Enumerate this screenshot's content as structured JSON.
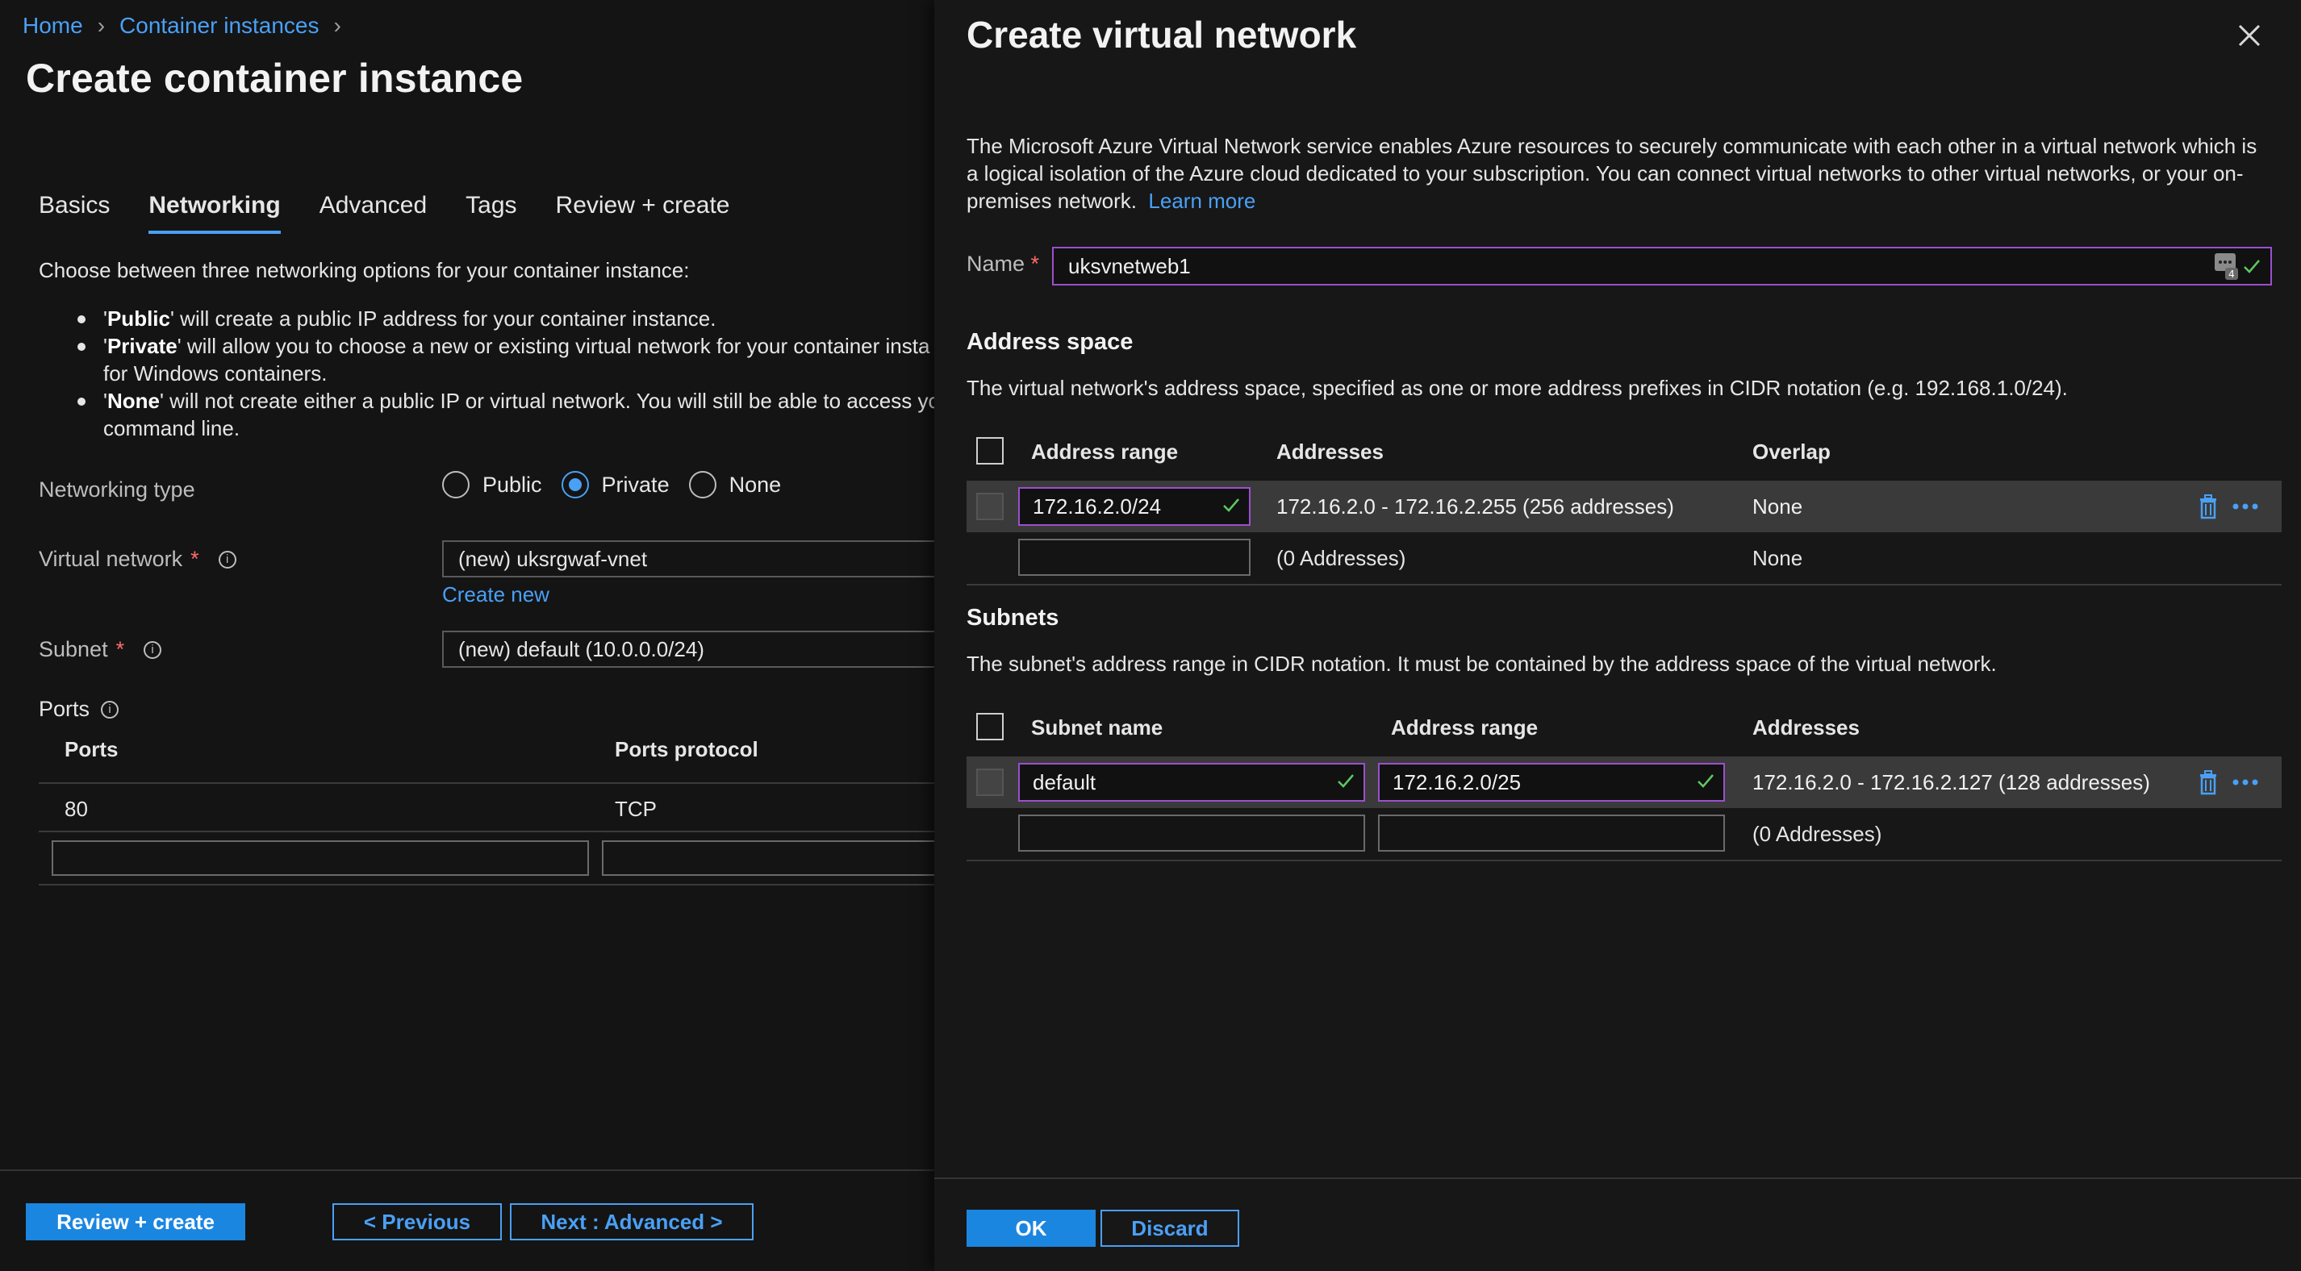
{
  "breadcrumb": {
    "home": "Home",
    "container_instances": "Container instances"
  },
  "page": {
    "title": "Create container instance"
  },
  "tabs": [
    {
      "label": "Basics"
    },
    {
      "label": "Networking"
    },
    {
      "label": "Advanced"
    },
    {
      "label": "Tags"
    },
    {
      "label": "Review + create"
    }
  ],
  "intro": "Choose between three networking options for your container instance:",
  "bullets": [
    {
      "bold": "Public",
      "text": "' will create a public IP address for your container instance."
    },
    {
      "bold": "Private",
      "text": "' will allow you to choose a new or existing virtual network for your container insta"
    },
    {
      "bold": "",
      "text": "for Windows containers."
    },
    {
      "bold": "None",
      "text": "' will not create either a public IP or virtual network. You will still be able to access yo"
    },
    {
      "bold": "",
      "text": "command line."
    }
  ],
  "networking": {
    "type_label": "Networking type",
    "options": [
      "Public",
      "Private",
      "None"
    ],
    "selected": "Private",
    "vnet_label": "Virtual network",
    "vnet_value": "(new) uksrgwaf-vnet",
    "create_new": "Create new",
    "subnet_label": "Subnet",
    "subnet_value": "(new) default (10.0.0.0/24)"
  },
  "ports": {
    "label": "Ports",
    "col_ports": "Ports",
    "col_protocol": "Ports protocol",
    "rows": [
      {
        "port": "80",
        "protocol": "TCP"
      }
    ]
  },
  "footer": {
    "review_create": "Review + create",
    "previous": "< Previous",
    "next": "Next : Advanced >"
  },
  "panel": {
    "title": "Create virtual network",
    "description": "The Microsoft Azure Virtual Network service enables Azure resources to securely communicate with each other in a virtual network which is a logical isolation of the Azure cloud dedicated to your subscription. You can connect virtual networks to other virtual networks, or your on-premises network.",
    "learn_more": "Learn more",
    "name_label": "Name",
    "name_value": "uksvnetweb1",
    "name_badge_count": "4",
    "address_space": {
      "title": "Address space",
      "description": "The virtual network's address space, specified as one or more address prefixes in CIDR notation (e.g. 192.168.1.0/24).",
      "col_range": "Address range",
      "col_addresses": "Addresses",
      "col_overlap": "Overlap",
      "rows": [
        {
          "range": "172.16.2.0/24",
          "addresses": "172.16.2.0 - 172.16.2.255 (256 addresses)",
          "overlap": "None"
        },
        {
          "range": "",
          "addresses": "(0 Addresses)",
          "overlap": "None"
        }
      ]
    },
    "subnets": {
      "title": "Subnets",
      "description": "The subnet's address range in CIDR notation. It must be contained by the address space of the virtual network.",
      "col_name": "Subnet name",
      "col_range": "Address range",
      "col_addresses": "Addresses",
      "rows": [
        {
          "name": "default",
          "range": "172.16.2.0/25",
          "addresses": "172.16.2.0 - 172.16.2.127 (128 addresses)"
        },
        {
          "name": "",
          "range": "",
          "addresses": "(0 Addresses)"
        }
      ]
    },
    "ok": "OK",
    "discard": "Discard"
  },
  "colors": {
    "accent": "#1b86e0",
    "link": "#4aa0f5",
    "valid": "#5fc85f",
    "focus_border": "#9b4fcf",
    "required": "#ff6b6b"
  }
}
